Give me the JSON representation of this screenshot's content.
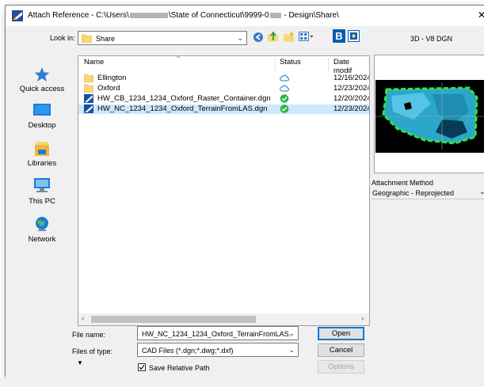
{
  "window": {
    "title_prefix": "Attach Reference - C:\\Users\\",
    "title_middle": "\\State of Connecticut\\9999-0",
    "title_suffix": " - Design\\Share\\",
    "close_glyph": "✕"
  },
  "lookin": {
    "label": "Look in:",
    "value": "Share"
  },
  "toolbar": {
    "icons": [
      "back-icon",
      "up-folder-icon",
      "new-folder-icon",
      "view-menu-icon",
      "bentley-b-icon",
      "thumbnail-icon"
    ],
    "b_glyph": "B"
  },
  "preview": {
    "label": "3D - V8 DGN"
  },
  "places": [
    {
      "label": "Quick access",
      "icon": "quick-access-icon"
    },
    {
      "label": "Desktop",
      "icon": "desktop-icon"
    },
    {
      "label": "Libraries",
      "icon": "libraries-icon"
    },
    {
      "label": "This PC",
      "icon": "this-pc-icon"
    },
    {
      "label": "Network",
      "icon": "network-icon"
    }
  ],
  "filelist": {
    "columns": [
      "Name",
      "Status",
      "Date modif"
    ],
    "rows": [
      {
        "name": "Ellington",
        "type": "folder",
        "status": "cloud",
        "date": "12/16/2024"
      },
      {
        "name": "Oxford",
        "type": "folder",
        "status": "cloud",
        "date": "12/23/2024"
      },
      {
        "name": "HW_CB_1234_1234_Oxford_Raster_Container.dgn",
        "type": "dgn",
        "status": "synced",
        "date": "12/20/2024"
      },
      {
        "name": "HW_NC_1234_1234_Oxford_TerrainFromLAS.dgn",
        "type": "dgn",
        "status": "synced",
        "date": "12/23/2024",
        "selected": true
      }
    ]
  },
  "attachment": {
    "label": "Attachment Method",
    "value": "Geographic - Reprojected"
  },
  "filename": {
    "label": "File name:",
    "value": "HW_NC_1234_1234_Oxford_TerrainFromLAS."
  },
  "filetype": {
    "label": "Files of type:",
    "value": "CAD Files (*.dgn;*.dwg;*.dxf)"
  },
  "buttons": {
    "open": "Open",
    "cancel": "Cancel",
    "options": "Options"
  },
  "save_relative": {
    "label": "Save Relative Path",
    "checked": true
  },
  "colors": {
    "selection": "#cce8ff",
    "accent": "#0078d7",
    "folder": "#f8d775",
    "synced": "#2db34a",
    "cloud": "#1e73be"
  }
}
